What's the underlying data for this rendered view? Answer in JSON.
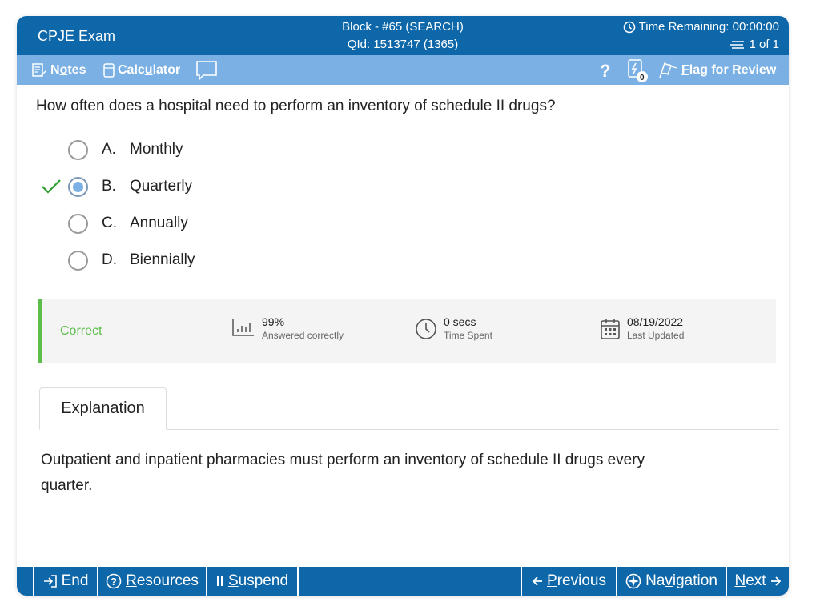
{
  "header": {
    "exam_title": "CPJE Exam",
    "block": "Block - #65 (SEARCH)",
    "qid": "QId: 1513747 (1365)",
    "time_remaining": "Time Remaining: 00:00:00",
    "item_count": "1 of 1"
  },
  "toolbar": {
    "notes_label_pre": "N",
    "notes_label_u": "o",
    "notes_label_post": "tes",
    "calculator_label_pre": "Calc",
    "calculator_label_u": "u",
    "calculator_label_post": "lator",
    "lab_badge": "0",
    "flag_label_u": "F",
    "flag_label_post": "lag for Review"
  },
  "question": {
    "text": "How often does a hospital need to perform an inventory of schedule II drugs?",
    "answers": [
      {
        "letter": "A.",
        "text": "Monthly"
      },
      {
        "letter": "B.",
        "text": "Quarterly"
      },
      {
        "letter": "C.",
        "text": "Annually"
      },
      {
        "letter": "D.",
        "text": "Biennially"
      }
    ],
    "selected_index": 1
  },
  "stats": {
    "result": "Correct",
    "percent": "99%",
    "percent_label": "Answered correctly",
    "time": "0 secs",
    "time_label": "Time Spent",
    "updated": "08/19/2022",
    "updated_label": "Last Updated"
  },
  "explanation": {
    "tab_label": "Explanation",
    "text": "Outpatient and inpatient pharmacies must perform an inventory of schedule II drugs every quarter."
  },
  "footer": {
    "end_label": "End",
    "resources_u": "R",
    "resources_post": "esources",
    "suspend_u": "S",
    "suspend_post": "uspend",
    "previous_u": "P",
    "previous_post": "revious",
    "navigation_pre": "Na",
    "navigation_u": "v",
    "navigation_post": "igation",
    "next_u": "N",
    "next_post": "ext"
  },
  "colors": {
    "header_blue": "#0d67a9",
    "toolbar_blue": "#7ab0e3",
    "correct_green": "#5cbf4a",
    "check_green": "#2e9e2e"
  }
}
